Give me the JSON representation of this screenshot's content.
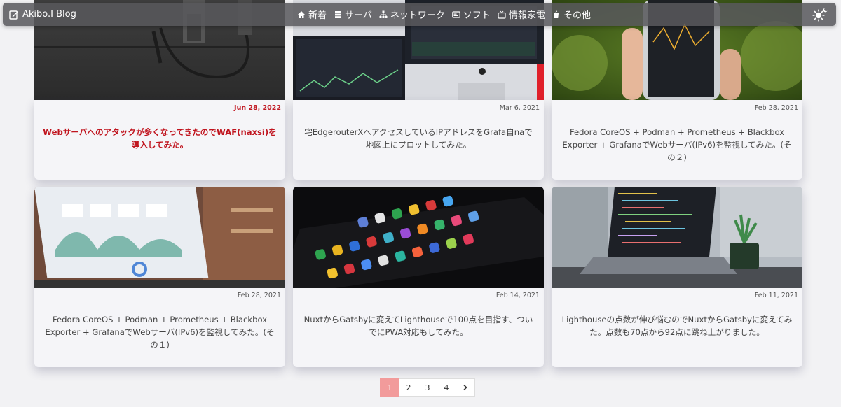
{
  "nav": {
    "brand": "Akibo.I Blog",
    "items": [
      {
        "label": "新着",
        "icon": "home-icon"
      },
      {
        "label": "サーバ",
        "icon": "server-icon"
      },
      {
        "label": "ネットワーク",
        "icon": "network-icon"
      },
      {
        "label": "ソフト",
        "icon": "window-icon"
      },
      {
        "label": "情報家電",
        "icon": "tv-icon"
      },
      {
        "label": "その他",
        "icon": "cup-icon"
      }
    ]
  },
  "posts": [
    {
      "date": "Jun 28, 2022",
      "title": "Webサーバへのアタックが多くなってきたのでWAF(naxsi)を導入してみた。"
    },
    {
      "date": "Mar 6, 2021",
      "title": "宅EdgerouterXへアクセスしているIPアドレスをGrafa自naで地図上にプロットしてみた。"
    },
    {
      "date": "Feb 28, 2021",
      "title": "Fedora CoreOS + Podman + Prometheus + Blackbox Exporter + GrafanaでWebサーバ(IPv6)を監視してみた。(その２)"
    },
    {
      "date": "Feb 28, 2021",
      "title": "Fedora CoreOS + Podman + Prometheus + Blackbox Exporter + GrafanaでWebサーバ(IPv6)を監視してみた。(その１)"
    },
    {
      "date": "Feb 14, 2021",
      "title": "NuxtからGatsbyに変えてLighthouseで100点を目指す、ついでにPWA対応もしてみた。"
    },
    {
      "date": "Feb 11, 2021",
      "title": "Lighthouseの点数が伸び悩むのでNuxtからGatsbyに変えてみた。点数も70点から92点に跳ね上がりました。"
    }
  ],
  "pagination": {
    "pages": [
      "1",
      "2",
      "3",
      "4"
    ],
    "active": "1",
    "next": "›"
  }
}
